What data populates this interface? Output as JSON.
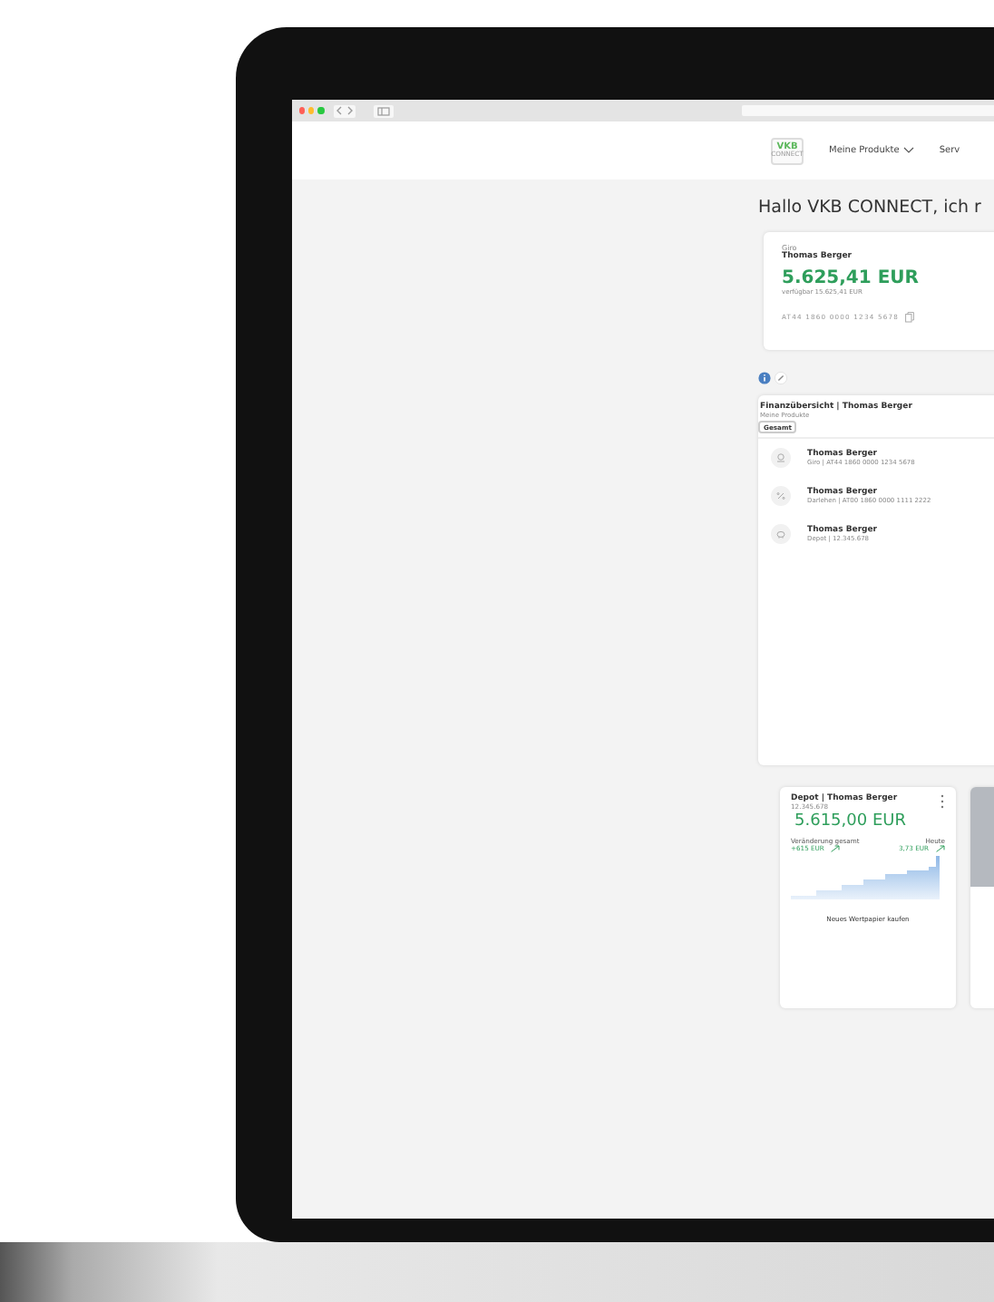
{
  "nav": {
    "logo": "VKB",
    "logo_sub": "CONNECT",
    "menu": [
      {
        "label": "Meine Produkte",
        "dropdown": true
      },
      {
        "label": "Serv",
        "dropdown": false
      }
    ]
  },
  "greeting": "Hallo VKB CONNECT, ich r",
  "account_card": {
    "type": "Giro",
    "owner": "Thomas Berger",
    "balance": "5.625,41 EUR",
    "available": "verfügbar 15.625,41 EUR",
    "iban": "AT44 1860 0000 1234 5678"
  },
  "overview": {
    "title": "Finanzübersicht | Thomas Berger",
    "subtitle": "Meine Produkte",
    "tabs": [
      {
        "label": "Gesamt",
        "selected": true
      }
    ],
    "products": [
      {
        "kind": "giro",
        "name": "Thomas Berger",
        "detail": "Giro | AT44 1860 0000 1234 5678"
      },
      {
        "kind": "loan",
        "name": "Thomas Berger",
        "detail": "Darlehen | AT00 1860 0000 1111 2222"
      },
      {
        "kind": "depot",
        "name": "Thomas Berger",
        "detail": "Depot | 12.345.678"
      }
    ]
  },
  "depot_card": {
    "title": "Depot | Thomas Berger",
    "number": "12.345.678",
    "value": "5.615,00 EUR",
    "change_label": "Veränderung gesamt",
    "change_value": "+615 EUR",
    "today_label": "Heute",
    "today_value": "3,73 EUR",
    "action": "Neues Wertpapier kaufen"
  }
}
